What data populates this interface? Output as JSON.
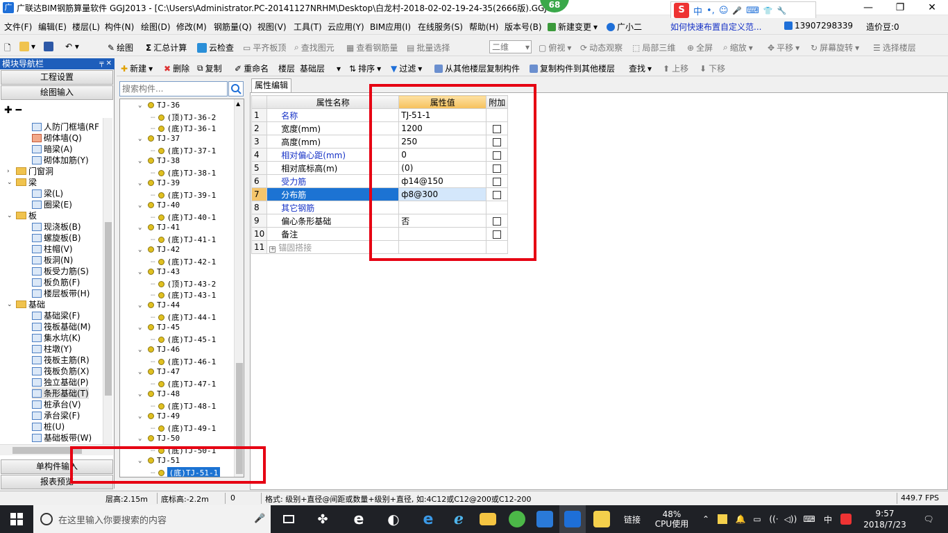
{
  "window": {
    "app_icon": "广",
    "title": "广联达BIM钢筋算量软件 GGJ2013 - [C:\\Users\\Administrator.PC-20141127NRHM\\Desktop\\白龙村-2018-02-02-19-24-35(2666版).GGJ12",
    "badge": "68",
    "min": "—",
    "max": "❐",
    "close": "✕",
    "ime": {
      "logo": "S",
      "lang": "中",
      "punct": "•,",
      "emoji": "☺",
      "mic": "🎤",
      "kbd": "⌨",
      "skin": "👕",
      "tool": "🔧"
    }
  },
  "menu": [
    "文件(F)",
    "编辑(E)",
    "楼层(L)",
    "构件(N)",
    "绘图(D)",
    "修改(M)",
    "钢筋量(Q)",
    "视图(V)",
    "工具(T)",
    "云应用(Y)",
    "BIM应用(I)",
    "在线服务(S)",
    "帮助(H)",
    "版本号(B)",
    "新建变更",
    "广小二",
    "如何快速布置自定义范...",
    "13907298339",
    "造价豆:0"
  ],
  "toolbar1": {
    "draw": "绘图",
    "sum": "汇总计算",
    "cloud_check": "云检查",
    "flat_top": "平齐板顶",
    "find_elem": "查找图元",
    "view_rebar": "查看钢筋量",
    "batch_sel": "批量选择",
    "view2d": "二维",
    "top_view": "俯视",
    "dyn_view": "动态观察",
    "local3d": "局部三维",
    "fullscreen": "全屏",
    "zoom": "缩放",
    "pan": "平移",
    "rotate": "屏幕旋转",
    "sel_floor": "选择楼层"
  },
  "nav": {
    "header": "模块导航栏",
    "pin": "╤ ✕",
    "btn_project": "工程设置",
    "btn_draw": "绘图输入",
    "btn_single": "单构件输入",
    "btn_report": "报表预览",
    "items": [
      {
        "label": "人防门框墙(RF"
      },
      {
        "label": "砌体墙(Q)"
      },
      {
        "label": "暗梁(A)"
      },
      {
        "label": "砌体加筋(Y)"
      },
      {
        "label": "门窗洞"
      },
      {
        "label": "梁"
      },
      {
        "label": "梁(L)"
      },
      {
        "label": "圈梁(E)"
      },
      {
        "label": "板"
      },
      {
        "label": "现浇板(B)"
      },
      {
        "label": "螺旋板(B)"
      },
      {
        "label": "柱帽(V)"
      },
      {
        "label": "板洞(N)"
      },
      {
        "label": "板受力筋(S)"
      },
      {
        "label": "板负筋(F)"
      },
      {
        "label": "楼层板带(H)"
      },
      {
        "label": "基础"
      },
      {
        "label": "基础梁(F)"
      },
      {
        "label": "筏板基础(M)"
      },
      {
        "label": "集水坑(K)"
      },
      {
        "label": "柱墩(Y)"
      },
      {
        "label": "筏板主筋(R)"
      },
      {
        "label": "筏板负筋(X)"
      },
      {
        "label": "独立基础(P)"
      },
      {
        "label": "条形基础(T)"
      },
      {
        "label": "桩承台(V)"
      },
      {
        "label": "承台梁(F)"
      },
      {
        "label": "桩(U)"
      },
      {
        "label": "基础板带(W)"
      }
    ]
  },
  "comp_toolbar": {
    "new": "新建",
    "delete": "删除",
    "copy": "复制",
    "rename": "重命名",
    "floor_lbl": "楼层",
    "floor_val": "基础层",
    "sort": "排序",
    "filter": "过滤",
    "copy_from": "从其他楼层复制构件",
    "copy_to": "复制构件到其他楼层",
    "find": "查找",
    "up": "上移",
    "down": "下移"
  },
  "search": {
    "placeholder": "搜索构件..."
  },
  "comp_tree": [
    {
      "label": "TJ-36",
      "level": 0
    },
    {
      "label": "(顶)TJ-36-2",
      "level": 1
    },
    {
      "label": "(底)TJ-36-1",
      "level": 1
    },
    {
      "label": "TJ-37",
      "level": 0
    },
    {
      "label": "(底)TJ-37-1",
      "level": 1
    },
    {
      "label": "TJ-38",
      "level": 0
    },
    {
      "label": "(底)TJ-38-1",
      "level": 1
    },
    {
      "label": "TJ-39",
      "level": 0
    },
    {
      "label": "(底)TJ-39-1",
      "level": 1
    },
    {
      "label": "TJ-40",
      "level": 0
    },
    {
      "label": "(底)TJ-40-1",
      "level": 1
    },
    {
      "label": "TJ-41",
      "level": 0
    },
    {
      "label": "(底)TJ-41-1",
      "level": 1
    },
    {
      "label": "TJ-42",
      "level": 0
    },
    {
      "label": "(底)TJ-42-1",
      "level": 1
    },
    {
      "label": "TJ-43",
      "level": 0
    },
    {
      "label": "(顶)TJ-43-2",
      "level": 1
    },
    {
      "label": "(底)TJ-43-1",
      "level": 1
    },
    {
      "label": "TJ-44",
      "level": 0
    },
    {
      "label": "(底)TJ-44-1",
      "level": 1
    },
    {
      "label": "TJ-45",
      "level": 0
    },
    {
      "label": "(底)TJ-45-1",
      "level": 1
    },
    {
      "label": "TJ-46",
      "level": 0
    },
    {
      "label": "(底)TJ-46-1",
      "level": 1
    },
    {
      "label": "TJ-47",
      "level": 0
    },
    {
      "label": "(底)TJ-47-1",
      "level": 1
    },
    {
      "label": "TJ-48",
      "level": 0
    },
    {
      "label": "(底)TJ-48-1",
      "level": 1
    },
    {
      "label": "TJ-49",
      "level": 0
    },
    {
      "label": "(底)TJ-49-1",
      "level": 1
    },
    {
      "label": "TJ-50",
      "level": 0
    },
    {
      "label": "(底)TJ-50-1",
      "level": 1
    },
    {
      "label": "TJ-51",
      "level": 0
    },
    {
      "label": "(底)TJ-51-1",
      "level": 1,
      "selected": true
    }
  ],
  "prop": {
    "tab": "属性编辑",
    "headers": {
      "name": "属性名称",
      "value": "属性值",
      "add": "附加"
    },
    "rows": [
      {
        "num": "1",
        "name": "名称",
        "value": "TJ-51-1",
        "blue": true,
        "cb": false
      },
      {
        "num": "2",
        "name": "宽度(mm)",
        "value": "1200",
        "blue": false,
        "cb": true
      },
      {
        "num": "3",
        "name": "高度(mm)",
        "value": "250",
        "blue": false,
        "cb": true
      },
      {
        "num": "4",
        "name": "相对偏心距(mm)",
        "value": "0",
        "blue": true,
        "cb": true
      },
      {
        "num": "5",
        "name": "相对底标高(m)",
        "value": "(0)",
        "blue": false,
        "cb": true
      },
      {
        "num": "6",
        "name": "受力筋",
        "value": "ф14@150",
        "blue": true,
        "cb": true
      },
      {
        "num": "7",
        "name": "分布筋",
        "value": "ф8@300",
        "blue": true,
        "cb": true,
        "selected": true
      },
      {
        "num": "8",
        "name": "其它钢筋",
        "value": "",
        "blue": true,
        "cb": false
      },
      {
        "num": "9",
        "name": "偏心条形基础",
        "value": "否",
        "blue": false,
        "cb": true
      },
      {
        "num": "10",
        "name": "备注",
        "value": "",
        "blue": false,
        "cb": true
      },
      {
        "num": "11",
        "name": "锚固搭接",
        "value": "",
        "blue": false,
        "cb": false,
        "expander": true
      }
    ]
  },
  "status": {
    "floor_h": "层高:2.15m",
    "bottom_h": "底标高:-2.2m",
    "zero": "0",
    "format": "格式: 级别+直径@间距或数量+级别+直径, 如:4C12或C12@200或C12-200",
    "fps": "449.7 FPS"
  },
  "taskbar": {
    "search": "在这里输入你要搜索的内容",
    "link": "链接",
    "cpu_pct": "48%",
    "cpu_lbl": "CPU使用",
    "lang": "中",
    "time": "9:57",
    "date": "2018/7/23"
  }
}
